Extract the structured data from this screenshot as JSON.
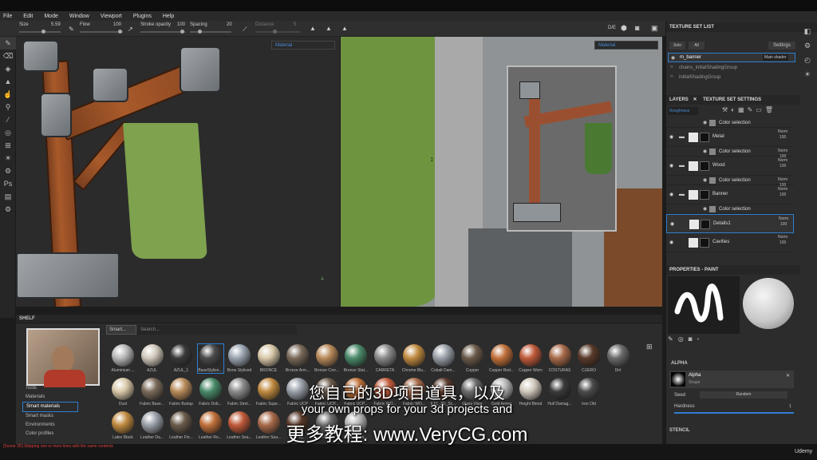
{
  "menu": [
    "File",
    "Edit",
    "Mode",
    "Window",
    "Viewport",
    "Plugins",
    "Help"
  ],
  "toolbar": {
    "size_label": "Size",
    "size_value": "5.59",
    "flow_label": "Flow",
    "flow_value": "100",
    "stroke_label": "Stroke opacity",
    "stroke_value": "100",
    "spacing_label": "Spacing",
    "spacing_value": "20",
    "distance_label": "Distance",
    "distance_value": "5",
    "view_label": "D/E"
  },
  "viewports": {
    "left_mode": "Material",
    "right_mode": "Material"
  },
  "texture_set_list": {
    "title": "TEXTURE SET LIST",
    "buttons": [
      "Solo",
      "All"
    ],
    "settings": "Settings",
    "items": [
      {
        "name": "m_banner",
        "shader": "Main shader"
      },
      {
        "name": "chains_initialShadingGroup"
      },
      {
        "name": "initialShadingGroup"
      }
    ]
  },
  "layers_panel": {
    "tabs": [
      "LAYERS",
      "TEXTURE SET SETTINGS"
    ],
    "channel": "Roughness",
    "rows": [
      {
        "name": "Color selection",
        "type": "mask",
        "norm": "",
        "opacity": ""
      },
      {
        "name": "Metal",
        "type": "folder",
        "norm": "Norm",
        "opacity": "100"
      },
      {
        "name": "Color selection",
        "type": "mask",
        "norm": "Norm",
        "opacity": "100"
      },
      {
        "name": "Wood",
        "type": "folder",
        "norm": "Norm",
        "opacity": "100"
      },
      {
        "name": "Color selection",
        "type": "mask",
        "norm": "Norm",
        "opacity": "100"
      },
      {
        "name": "Banner",
        "type": "folder",
        "norm": "Norm",
        "opacity": "100"
      },
      {
        "name": "Color selection",
        "type": "mask",
        "norm": "",
        "opacity": ""
      },
      {
        "name": "Details1",
        "type": "layer",
        "norm": "Norm",
        "opacity": "100"
      },
      {
        "name": "Cavities",
        "type": "layer",
        "norm": "Norm",
        "opacity": "100"
      }
    ]
  },
  "properties": {
    "title": "PROPERTIES - PAINT",
    "alpha_section": "ALPHA",
    "alpha_name": "Alpha",
    "alpha_shape": "Shape",
    "seed_label": "Seed",
    "seed_value": "Random",
    "hardness_label": "Hardness",
    "hardness_value": "1",
    "stencil_section": "STENCIL"
  },
  "shelf": {
    "title": "SHELF",
    "tab_active": "Smart...",
    "search_placeholder": "Search...",
    "categories": [
      "Tools",
      "Materials",
      "Smart materials",
      "Smart masks",
      "Environments",
      "Color profiles"
    ],
    "selected_category": "Smart materials",
    "row1": [
      "Aluminium ...",
      "AZUL",
      "AZUL_1",
      "BaseStylize...",
      "Bone Stylized",
      "BRONCE",
      "Bronze Arm...",
      "Bronze Corr...",
      "Bronze Stat...",
      "CARRETA",
      "Chrome Blu...",
      "Cobalt Dam...",
      "Copper",
      "Copper Red...",
      "Copper Worn",
      "COSTURAS",
      "CUERO",
      "Dirt"
    ],
    "row2": [
      "Dust",
      "Fabric Base...",
      "Fabric Burlap",
      "Fabric Dob...",
      "Fabric Stret...",
      "Fabric Supe...",
      "Fabric UCP",
      "Fabric UCP...",
      "Fabric UCP...",
      "Fabric WO...",
      "Fabric WO...",
      "FTC_3D_Sc...",
      "Glass Visor",
      "Gold Armor",
      "Height Blend",
      "Hull Damag...",
      "Iron Old"
    ],
    "row3": [
      "Latex Black",
      "Leather Da...",
      "Leather Fin...",
      "Leather Ro...",
      "Leather Sea...",
      "Leather Sea...",
      "PAPEL",
      "PIEL",
      "Plastic Arm..."
    ]
  },
  "status": {
    "message": "[Scene 3D] Skipping one or more lines with the same contents",
    "brand": "Udemy"
  },
  "subtitles": {
    "line1": "您自己的3D项目道具，以及",
    "line2": "your own props for your 3d projects and",
    "line3": "更多教程: www.VeryCG.com"
  },
  "colors": {
    "accent": "#2f7fd0",
    "banner": "#7ea24e",
    "wood": "#a85a2a",
    "watermark": "#2a6fd8"
  }
}
